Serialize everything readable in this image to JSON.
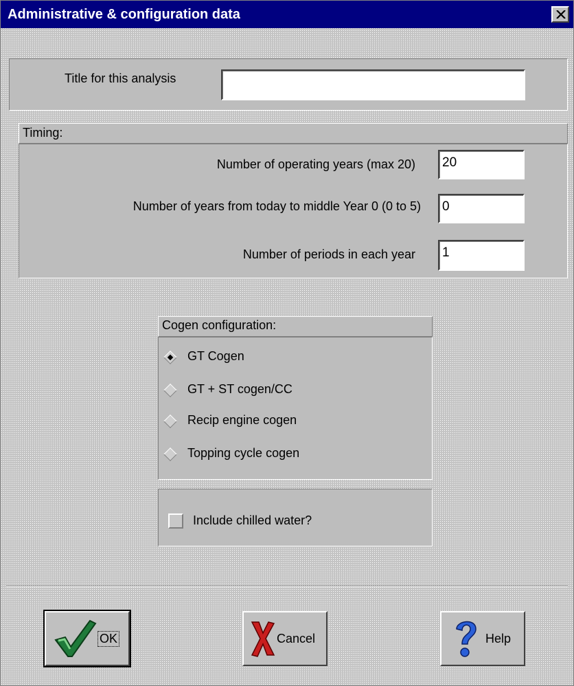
{
  "window": {
    "title": "Administrative & configuration data"
  },
  "title_section": {
    "label": "Title for this analysis",
    "value": ""
  },
  "timing": {
    "heading": "Timing:",
    "fields": [
      {
        "label": "Number of operating years (max 20)",
        "value": "20"
      },
      {
        "label": "Number of years from today to middle Year 0 (0 to 5)",
        "value": "0"
      },
      {
        "label": "Number of periods in each year",
        "value": "1"
      }
    ]
  },
  "cogen": {
    "heading": "Cogen configuration:",
    "options": [
      {
        "label": "GT Cogen",
        "selected": true
      },
      {
        "label": "GT + ST cogen/CC",
        "selected": false
      },
      {
        "label": "Recip engine cogen",
        "selected": false
      },
      {
        "label": "Topping cycle cogen",
        "selected": false
      }
    ]
  },
  "chilled_water": {
    "label": "Include chilled water?",
    "checked": false
  },
  "buttons": {
    "ok": "OK",
    "cancel": "Cancel",
    "help": "Help"
  },
  "icons": {
    "close": "close-icon",
    "ok": "checkmark-icon",
    "cancel": "x-icon",
    "help": "question-mark-icon"
  }
}
